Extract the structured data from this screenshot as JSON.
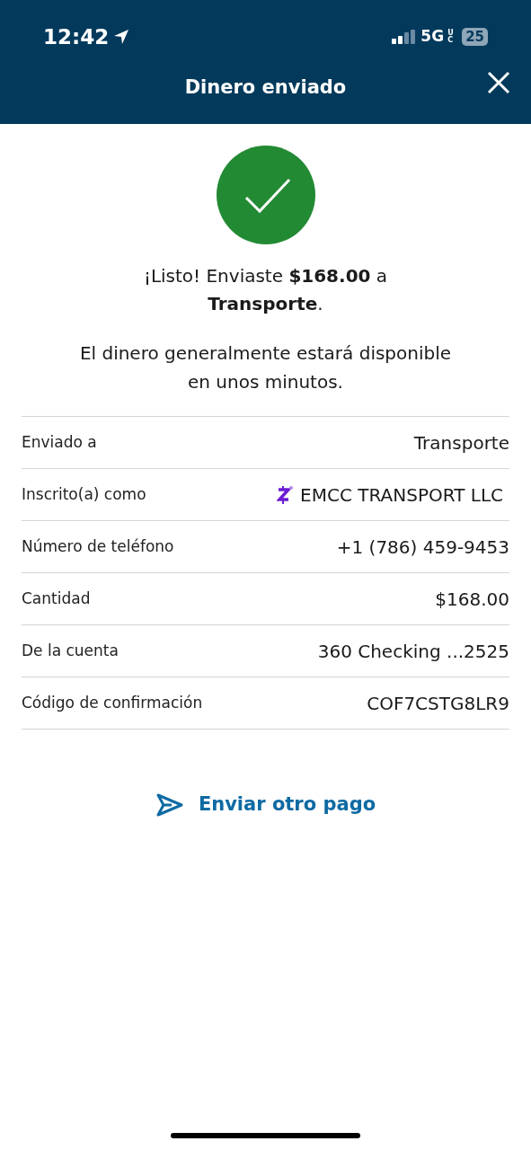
{
  "status_bar": {
    "time": "12:42",
    "network": "5G",
    "network_badge": "UC",
    "battery": "25"
  },
  "header": {
    "title": "Dinero enviado"
  },
  "message": "¡Listo! Enviaste **$168.00** a **Transporte**.",
  "note": "El dinero generalmente estará disponible en unos minutos.",
  "details": [
    {
      "kind": "text",
      "label": "Enviado a",
      "value": "Transporte"
    },
    {
      "kind": "zelle",
      "label": "Inscrito(a) como",
      "value": "EMCC TRANSPORT LLC"
    },
    {
      "kind": "text",
      "label": "Número de teléfono",
      "value": "+1 (786) 459-9453"
    },
    {
      "kind": "text",
      "label": "Cantidad",
      "value": "$168.00"
    },
    {
      "kind": "text",
      "label": "De la cuenta",
      "value": "360 Checking ...2525"
    },
    {
      "kind": "text",
      "label": "Código de confirmación",
      "value": "COF7CSTG8LR9"
    }
  ],
  "action": {
    "label": "Enviar otro pago"
  }
}
